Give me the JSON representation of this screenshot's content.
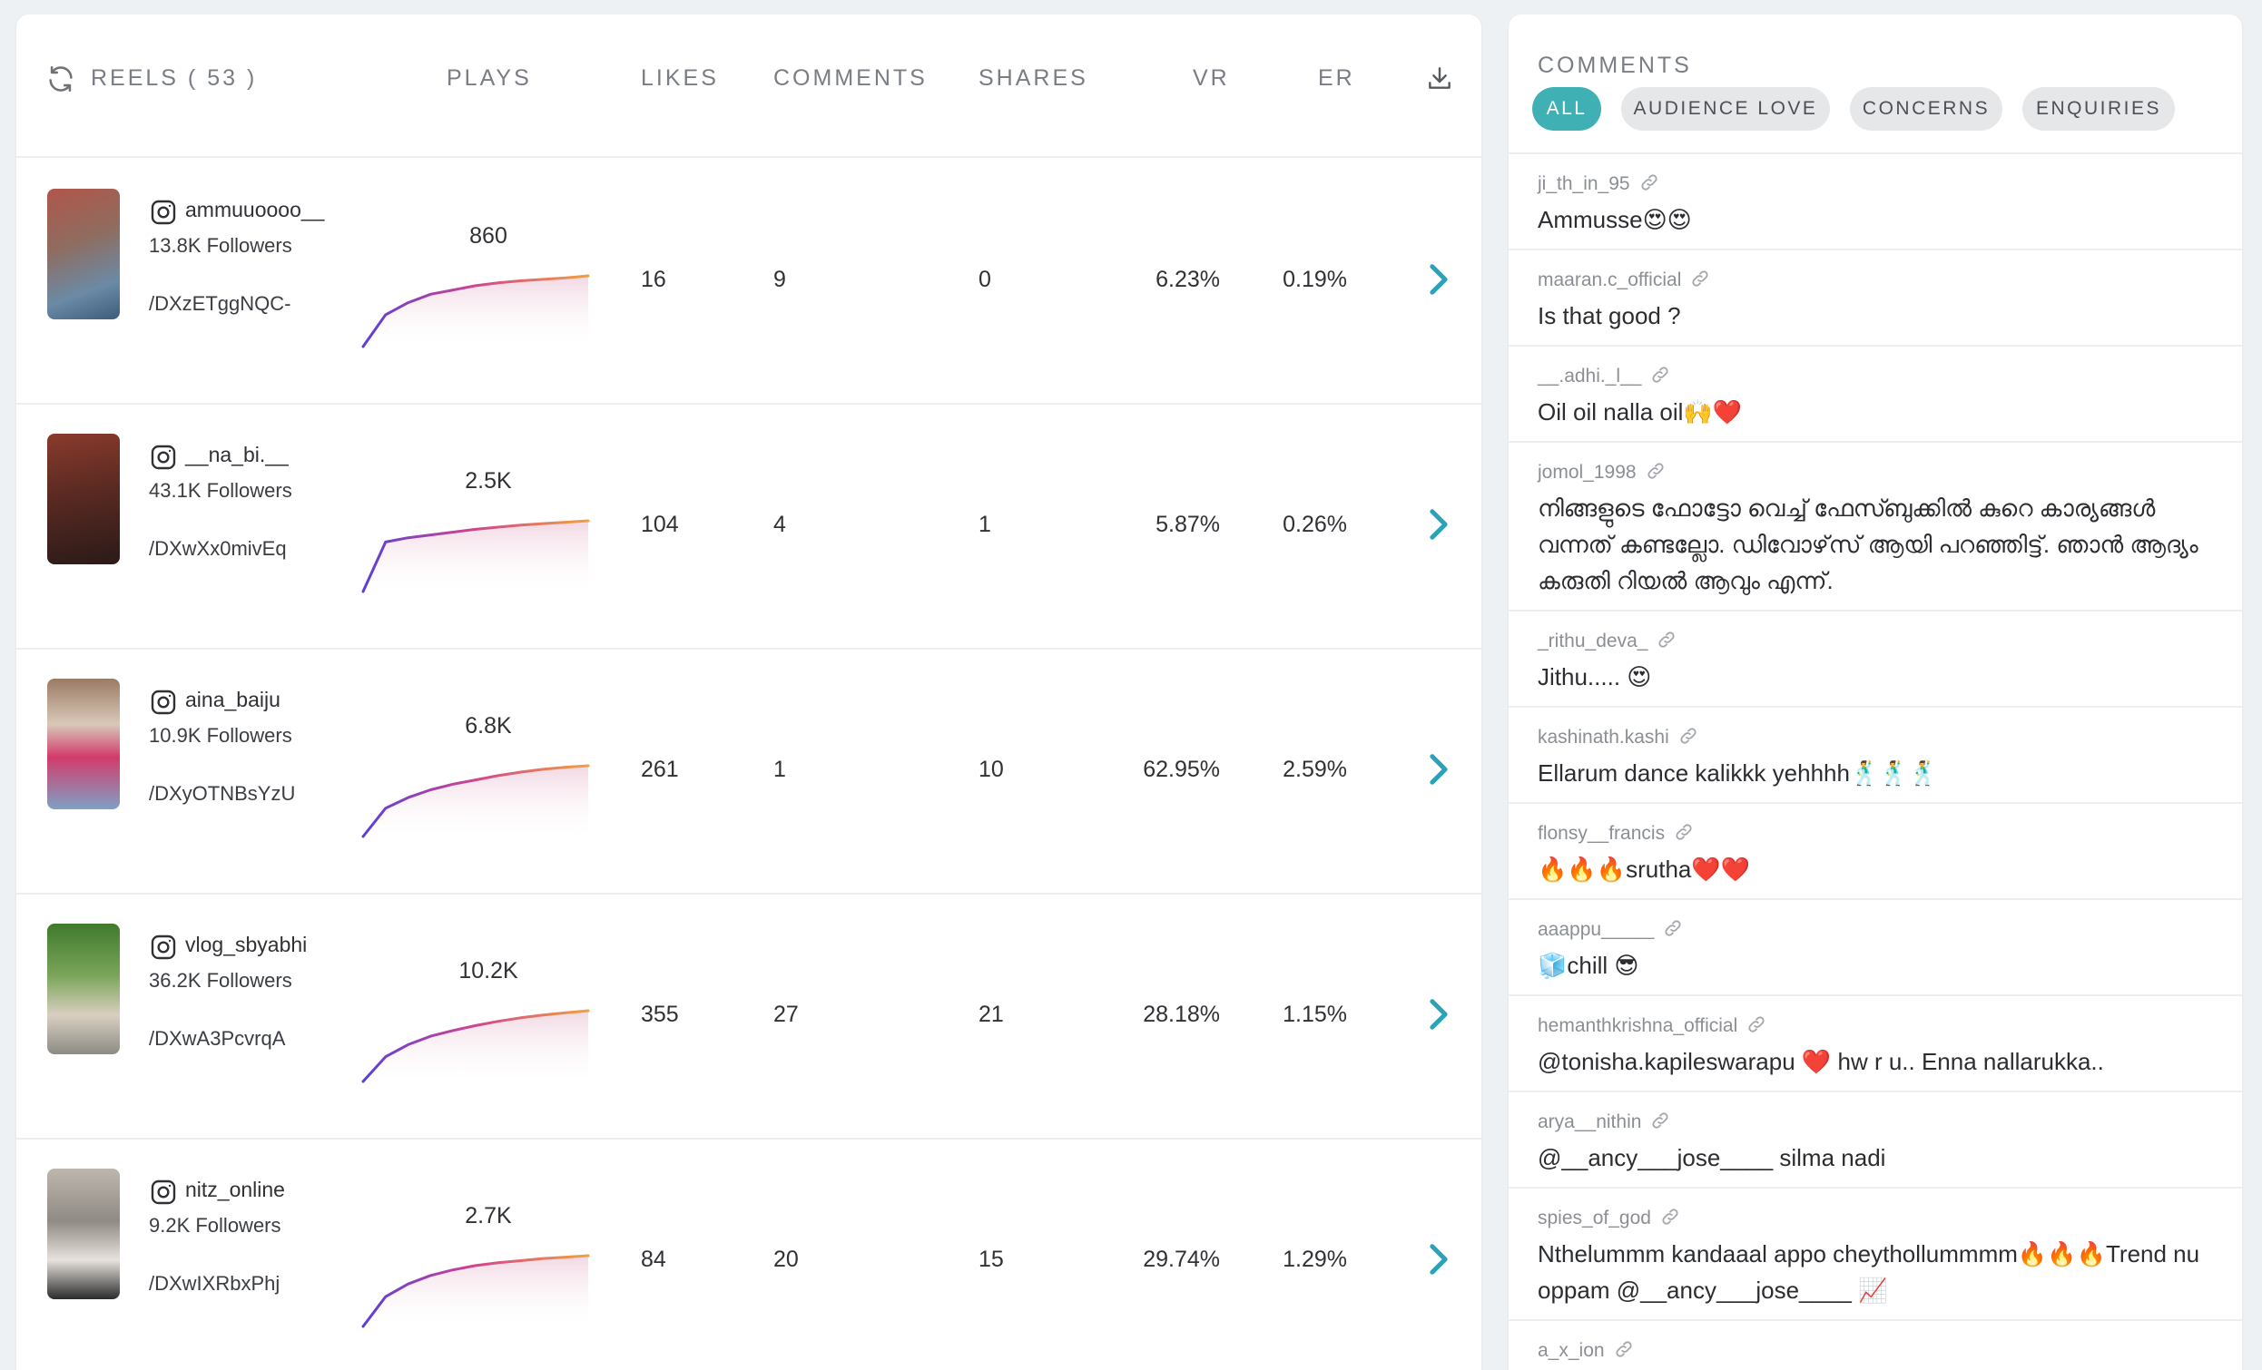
{
  "reels_table": {
    "headers": {
      "reels": "REELS ( 53 )",
      "plays": "PLAYS",
      "likes": "LIKES",
      "comments": "COMMENTS",
      "shares": "SHARES",
      "vr": "VR",
      "er": "ER"
    },
    "rows": [
      {
        "username": "ammuuoooo__",
        "followers": "13.8K Followers",
        "shortcode": "/DXzETggNQC-",
        "plays": "860",
        "likes": "16",
        "comments": "9",
        "shares": "0",
        "vr": "6.23%",
        "er": "0.19%"
      },
      {
        "username": "__na_bi.__",
        "followers": "43.1K Followers",
        "shortcode": "/DXwXx0mivEq",
        "plays": "2.5K",
        "likes": "104",
        "comments": "4",
        "shares": "1",
        "vr": "5.87%",
        "er": "0.26%"
      },
      {
        "username": "aina_baiju",
        "followers": "10.9K Followers",
        "shortcode": "/DXyOTNBsYzU",
        "plays": "6.8K",
        "likes": "261",
        "comments": "1",
        "shares": "10",
        "vr": "62.95%",
        "er": "2.59%"
      },
      {
        "username": "vlog_sbyabhi",
        "followers": "36.2K Followers",
        "shortcode": "/DXwA3PcvrqA",
        "plays": "10.2K",
        "likes": "355",
        "comments": "27",
        "shares": "21",
        "vr": "28.18%",
        "er": "1.15%"
      },
      {
        "username": "nitz_online",
        "followers": "9.2K Followers",
        "shortcode": "/DXwIXRbxPhj",
        "plays": "2.7K",
        "likes": "84",
        "comments": "20",
        "shares": "15",
        "vr": "29.74%",
        "er": "1.29%"
      }
    ]
  },
  "comments_panel": {
    "title": "COMMENTS",
    "filters": [
      {
        "label": "ALL",
        "active": true
      },
      {
        "label": "AUDIENCE LOVE",
        "active": false
      },
      {
        "label": "CONCERNS",
        "active": false
      },
      {
        "label": "ENQUIRIES",
        "active": false
      }
    ],
    "items": [
      {
        "user": "ji_th_in_95",
        "text": "Ammusse😍😍"
      },
      {
        "user": "maaran.c_official",
        "text": "Is that good ?"
      },
      {
        "user": "__.adhi._l__",
        "text": "Oil oil nalla oil🙌❤️"
      },
      {
        "user": "jomol_1998",
        "text": "നിങ്ങളുടെ ഫോട്ടോ വെച്ച് ഫേസ്ബുക്കിൽ കുറെ കാര്യങ്ങൾ വന്നത് കണ്ടല്ലോ. ഡിവോഴ്‌സ് ആയി പറഞ്ഞിട്ട്. ഞാൻ ആദ്യം കരുതി റിയൽ ആവും എന്ന്."
      },
      {
        "user": "_rithu_deva_",
        "text": "Jithu..... 😍"
      },
      {
        "user": "kashinath.kashi",
        "text": "Ellarum dance kalikkk yehhhh🕺🕺🕺"
      },
      {
        "user": "flonsy__francis",
        "text": "🔥🔥🔥srutha❤️❤️"
      },
      {
        "user": "aaappu_____",
        "text": "🧊chill 😎"
      },
      {
        "user": "hemanthkrishna_official",
        "text": "@tonisha.kapileswarapu ❤️ hw r u.. Enna nallarukka.."
      },
      {
        "user": "arya__nithin",
        "text": "@__ancy___jose____ silma nadi"
      },
      {
        "user": "spies_of_god",
        "text": "Nthelummm kandaaal appo cheythollummmm🔥🔥🔥Trend nu oppam @__ancy___jose____ 📈"
      },
      {
        "user": "a_x_ion",
        "text": ""
      }
    ]
  },
  "colors": {
    "accent": "#3fb1b5",
    "chevron": "#2aa3b8",
    "spark_start": "#5b3fd6",
    "spark_mid": "#d0458e",
    "spark_end": "#f2a03d"
  },
  "icons": [
    "refresh-icon",
    "download-icon",
    "instagram-icon",
    "chevron-right-icon",
    "link-icon"
  ]
}
